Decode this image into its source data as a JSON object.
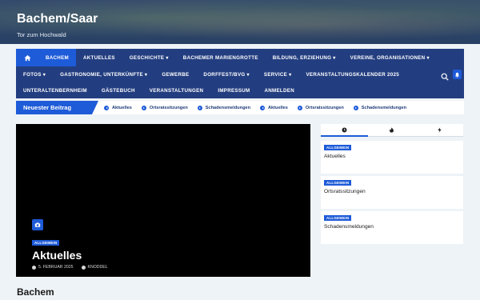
{
  "site": {
    "title": "Bachem/Saar",
    "tagline": "Tor zum Hochwald"
  },
  "nav": {
    "row1": [
      "BACHEM",
      "AKTUELLES",
      "GESCHICHTE ▾",
      "BACHEMER MARIENGROTTE",
      "BILDUNG, ERZIEHUNG ▾",
      "VEREINE, ORGANISATIONEN ▾"
    ],
    "row2": [
      "FOTOS ▾",
      "GASTRONOMIE, UNTERKÜNFTE ▾",
      "GEWERBE",
      "DORFFEST/BVG ▾",
      "SERVICE ▾",
      "VERANSTALTUNGSKALENDER 2025"
    ],
    "row3": [
      "UNTERALTENBERNHEIM",
      "GÄSTEBUCH",
      "VERANSTALTUNGEN",
      "IMPRESSUM",
      "ANMELDEN"
    ]
  },
  "ticker": {
    "label": "Neuester Beitrag",
    "items": [
      "Aktuelles",
      "Ortsratssitzungen",
      "Schadensmeldungen",
      "Aktuelles",
      "Ortsratssitzungen",
      "Schadensmeldungen"
    ]
  },
  "featured": {
    "category": "ALLGEMEIN",
    "title": "Aktuelles",
    "date": "5. FEBRUAR 2025",
    "author": "KNODDEL"
  },
  "sidebar": {
    "tabs": [
      "clock-icon",
      "fire-icon",
      "bolt-icon"
    ],
    "cards": [
      {
        "category": "ALLGEMEIN",
        "title": "Aktuelles"
      },
      {
        "category": "ALLGEMEIN",
        "title": "Ortsratssitzungen"
      },
      {
        "category": "ALLGEMEIN",
        "title": "Schadensmeldungen"
      }
    ]
  },
  "section": {
    "title": "Bachem"
  },
  "colors": {
    "nav_bg": "#233e80",
    "accent": "#1e5bd8",
    "page_bg": "#eef3f7"
  }
}
